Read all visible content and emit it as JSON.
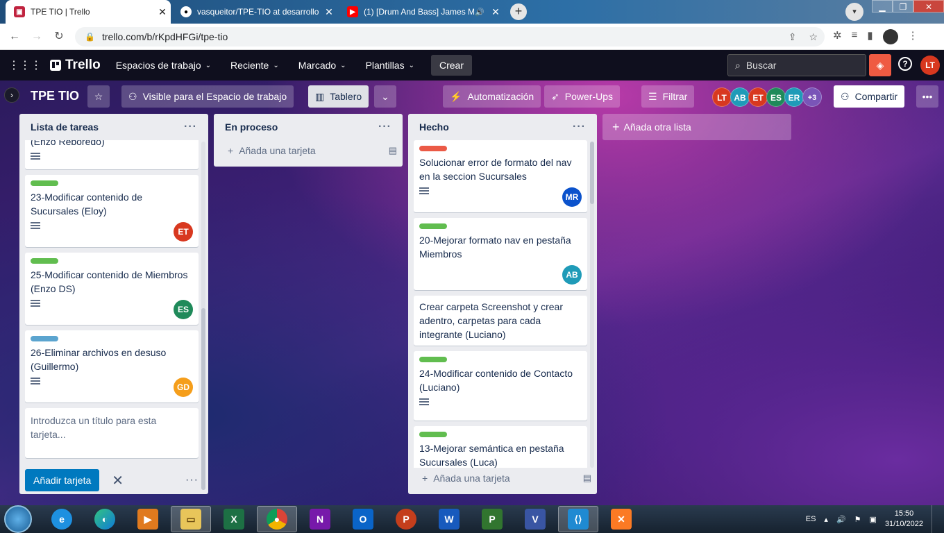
{
  "browser": {
    "tabs": [
      {
        "title": "TPE TIO | Trello",
        "favicon": "trello-icon",
        "active": true
      },
      {
        "title": "vasqueitor/TPE-TIO at desarrollo",
        "favicon": "github-icon",
        "active": false
      },
      {
        "title": "(1) [Drum And Bass] James M",
        "favicon": "youtube-icon",
        "active": false
      }
    ],
    "url": "trello.com/b/rKpdHFGi/tpe-tio"
  },
  "header": {
    "logo": "Trello",
    "menus": [
      "Espacios de trabajo",
      "Reciente",
      "Marcado",
      "Plantillas"
    ],
    "create": "Crear",
    "search_placeholder": "Buscar",
    "user_initials": "LT"
  },
  "board": {
    "title": "TPE TIO",
    "visibility": "Visible para el Espacio de trabajo",
    "view": "Tablero",
    "automation": "Automatización",
    "powerups": "Power-Ups",
    "filter": "Filtrar",
    "members": [
      {
        "initials": "LT",
        "color": "#d8381f"
      },
      {
        "initials": "AB",
        "color": "#1f9bb8"
      },
      {
        "initials": "ET",
        "color": "#d8381f"
      },
      {
        "initials": "ES",
        "color": "#1f8a5a"
      },
      {
        "initials": "ER",
        "color": "#1f9bb8"
      },
      {
        "initials": "+3",
        "color": "#7a55b8"
      }
    ],
    "share": "Compartir",
    "add_list": "Añada otra lista"
  },
  "lists": [
    {
      "title": "Lista de tareas",
      "cards": [
        {
          "label": null,
          "text": "(Enzo Reboredo)",
          "desc": true,
          "avatar": null
        },
        {
          "label": "#61bd4f",
          "text": "23-Modificar contenido de Sucursales (Eloy)",
          "desc": true,
          "avatar": {
            "initials": "ET",
            "color": "#d8381f"
          }
        },
        {
          "label": "#61bd4f",
          "text": "25-Modificar contenido de Miembros (Enzo DS)",
          "desc": true,
          "avatar": {
            "initials": "ES",
            "color": "#1f8a5a"
          }
        },
        {
          "label": "#5ba4cf",
          "text": "26-Eliminar archivos en desuso (Guillermo)",
          "desc": true,
          "avatar": {
            "initials": "GD",
            "color": "#f59e1b"
          }
        }
      ],
      "composer_placeholder": "Introduzca un título para esta tarjeta...",
      "add_button": "Añadir tarjeta"
    },
    {
      "title": "En proceso",
      "cards": [],
      "add_card": "Añada una tarjeta"
    },
    {
      "title": "Hecho",
      "cards": [
        {
          "label": "#eb5a46",
          "text": "Solucionar error de formato del nav en la seccion Sucursales",
          "desc": true,
          "avatar": {
            "initials": "MR",
            "color": "#0b52cc"
          }
        },
        {
          "label": "#61bd4f",
          "text": "20-Mejorar formato nav en pestaña Miembros",
          "desc": false,
          "avatar": {
            "initials": "AB",
            "color": "#1f9bb8"
          }
        },
        {
          "label": null,
          "text": "Crear carpeta Screenshot y crear adentro, carpetas para cada integrante (Luciano)",
          "desc": false,
          "avatar": null
        },
        {
          "label": "#61bd4f",
          "text": "24-Modificar contenido de Contacto (Luciano)",
          "desc": true,
          "avatar": null
        },
        {
          "label": "#61bd4f",
          "text": "13-Mejorar semántica en pestaña Sucursales (Luca)",
          "desc": false,
          "avatar": null
        }
      ],
      "add_card": "Añada una tarjeta"
    }
  ],
  "taskbar": {
    "apps": [
      "ie-icon",
      "edge-icon",
      "media-icon",
      "explorer-icon",
      "excel-icon",
      "chrome-icon",
      "onenote-icon",
      "outlook-icon",
      "powerpoint-icon",
      "word-icon",
      "project-icon",
      "visio-icon",
      "vscode-icon",
      "xampp-icon"
    ],
    "lang": "ES",
    "time": "15:50",
    "date": "31/10/2022"
  }
}
